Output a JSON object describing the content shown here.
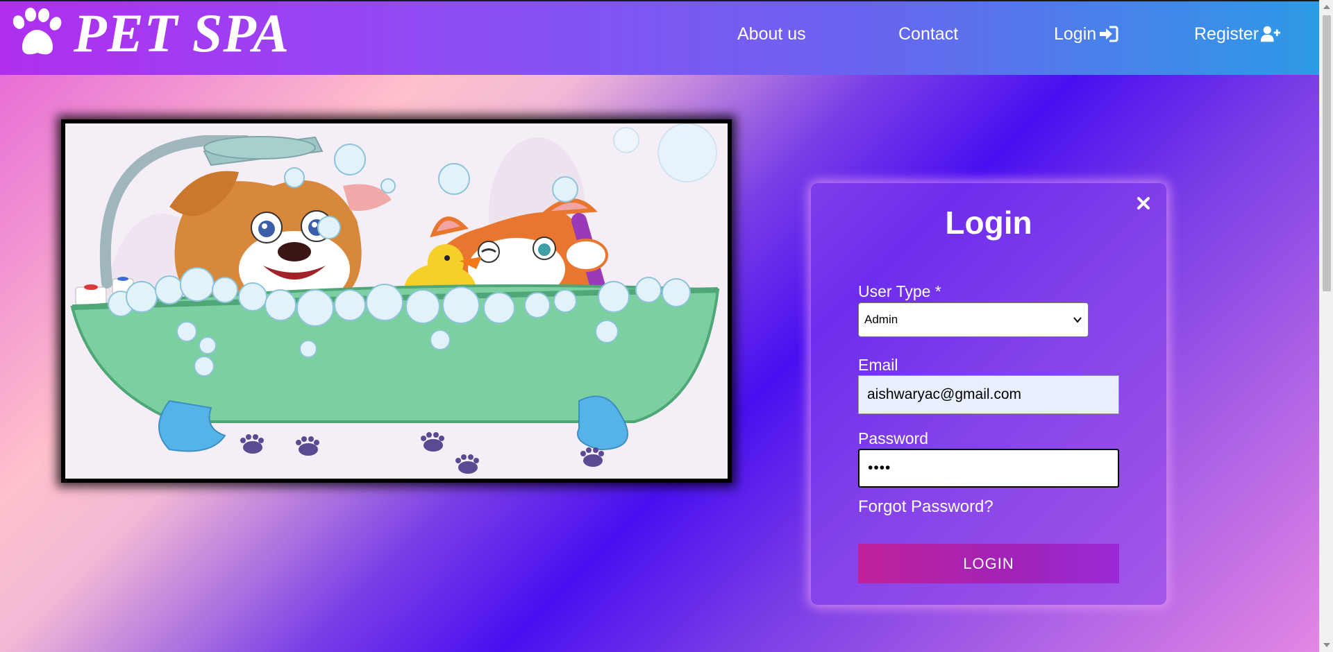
{
  "brand": {
    "title": "PET SPA",
    "icon": "paw-icon"
  },
  "nav": {
    "about": "About us",
    "contact": "Contact",
    "login": "Login",
    "login_icon": "sign-in-icon",
    "register": "Register",
    "register_icon": "user-plus-icon"
  },
  "hero": {
    "image": "cartoon dog and cat in bubble bath illustration"
  },
  "login_form": {
    "title": "Login",
    "close_icon": "close-icon",
    "user_type_label": "User Type *",
    "user_type_value": "Admin",
    "email_label": "Email",
    "email_value": "aishwaryac@gmail.com",
    "password_label": "Password",
    "password_value": "••••",
    "forgot_password": "Forgot Password?",
    "submit_label": "LOGIN"
  },
  "colors": {
    "navbar_start": "#b02ef0",
    "navbar_end": "#2d9ae6",
    "button_start": "#c0219a",
    "button_end": "#9a2ad6",
    "email_autofill_bg": "#e8f0fe"
  }
}
